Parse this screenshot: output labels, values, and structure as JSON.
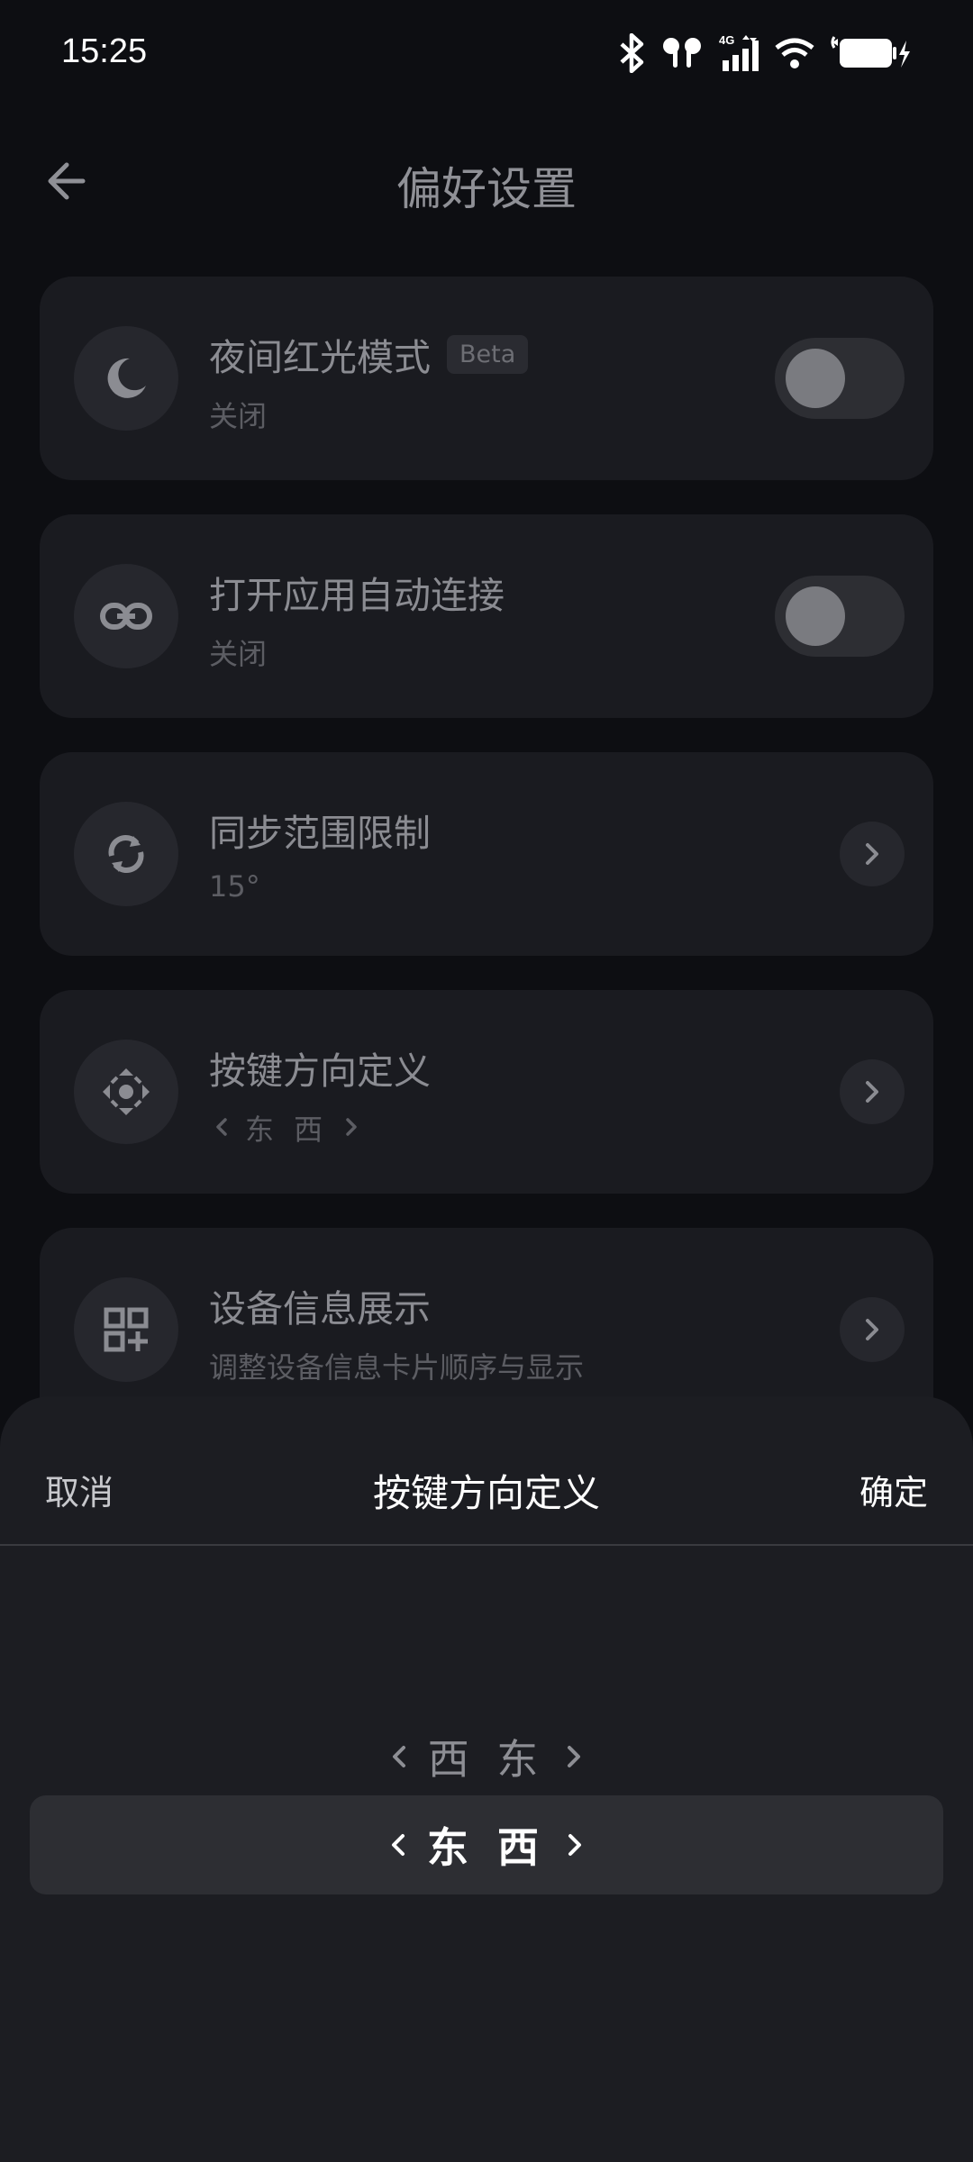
{
  "status_bar": {
    "time": "15:25",
    "network": "4G"
  },
  "header": {
    "title": "偏好设置"
  },
  "settings": [
    {
      "title": "夜间红光模式",
      "badge": "Beta",
      "subtitle": "关闭",
      "icon": "moon-icon",
      "control": "toggle",
      "enabled": false
    },
    {
      "title": "打开应用自动连接",
      "subtitle": "关闭",
      "icon": "link-icon",
      "control": "toggle",
      "enabled": false
    },
    {
      "title": "同步范围限制",
      "subtitle": "15°",
      "icon": "sync-icon",
      "control": "chevron"
    },
    {
      "title": "按键方向定义",
      "subtitle": "东 西",
      "icon": "direction-pad-icon",
      "control": "chevron"
    },
    {
      "title": "设备信息展示",
      "subtitle": "调整设备信息卡片顺序与显示",
      "icon": "widgets-add-icon",
      "control": "chevron"
    }
  ],
  "sheet": {
    "cancel": "取消",
    "title": "按键方向定义",
    "confirm": "确定",
    "options": [
      "西 东",
      "东 西"
    ],
    "selected": "东 西"
  },
  "colors": {
    "background": "#0d0e12",
    "card": "#1a1b20",
    "sheet": "#1c1d22"
  }
}
